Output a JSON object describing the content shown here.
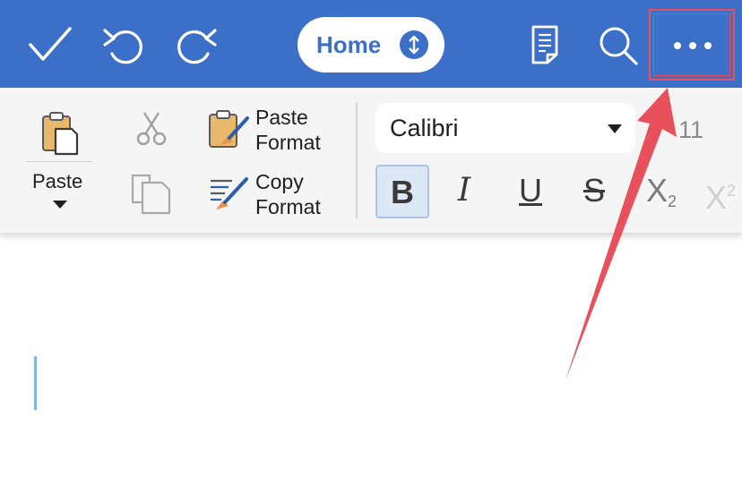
{
  "toolbar": {
    "done_icon": "checkmark-icon",
    "undo_icon": "undo-icon",
    "redo_icon": "redo-icon",
    "tab_label": "Home",
    "tab_switch_icon": "up-down-arrows-icon",
    "reading_view_icon": "document-icon",
    "search_icon": "search-icon",
    "more_icon": "ellipsis-icon"
  },
  "ribbon": {
    "paste_label": "Paste",
    "paste_format_line1": "Paste",
    "paste_format_line2": "Format",
    "copy_format_line1": "Copy",
    "copy_format_line2": "Format",
    "font_name": "Calibri",
    "font_size": "11",
    "format_buttons": {
      "bold": "B",
      "italic": "I",
      "underline": "U",
      "strikethrough": "S",
      "subscript": "X",
      "subscript_mark": "2",
      "superscript": "X",
      "superscript_mark": "2"
    }
  },
  "colors": {
    "toolbar_bg": "#3b6fc8",
    "highlight_box": "#e8505b",
    "annotation_arrow": "#e8505b"
  }
}
